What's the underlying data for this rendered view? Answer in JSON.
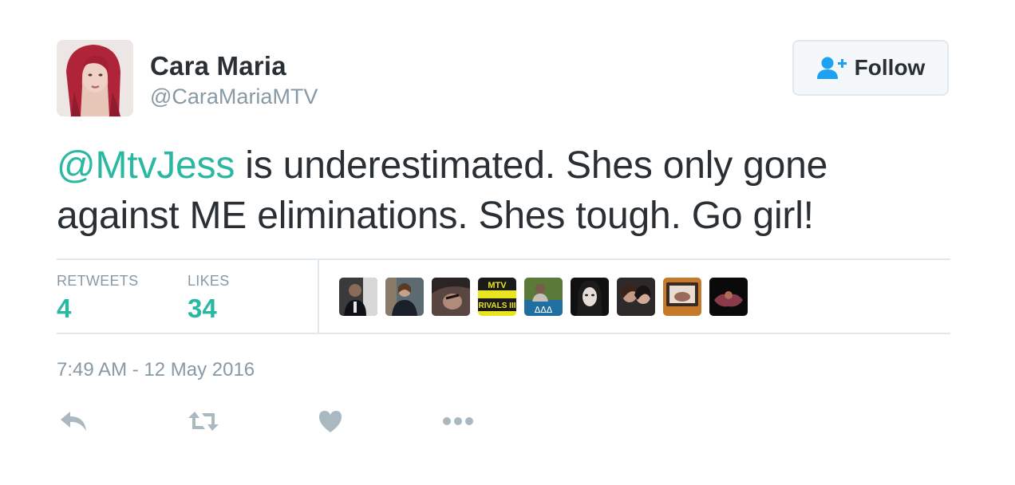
{
  "user": {
    "name": "Cara Maria",
    "handle": "@CaraMariaMTV"
  },
  "follow_button": {
    "label": "Follow",
    "icon": "add-user-icon"
  },
  "tweet": {
    "mention": "@MtvJess",
    "line1_rest": " is underestimated. Shes only gone",
    "line2": "against ME eliminations. Shes tough. Go girl!"
  },
  "stats": {
    "retweets_label": "RETWEETS",
    "retweets_count": "4",
    "likes_label": "LIKES",
    "likes_count": "34"
  },
  "likers": [
    {
      "name": "liker-avatar-1"
    },
    {
      "name": "liker-avatar-2"
    },
    {
      "name": "liker-avatar-3"
    },
    {
      "name": "liker-avatar-4",
      "text_top": "MTV",
      "text_bottom": "RIVALS III"
    },
    {
      "name": "liker-avatar-5",
      "text": "ΔΔΔ"
    },
    {
      "name": "liker-avatar-6"
    },
    {
      "name": "liker-avatar-7"
    },
    {
      "name": "liker-avatar-8"
    },
    {
      "name": "liker-avatar-9"
    }
  ],
  "timestamp": "7:49 AM - 12 May 2016",
  "actions": [
    "reply-icon",
    "retweet-icon",
    "like-heart-icon",
    "more-icon"
  ],
  "colors": {
    "accent_green": "#2ab8a0",
    "follow_icon_blue": "#1da1f2",
    "muted_gray": "#8899a6",
    "action_gray": "#aab8c2",
    "text_dark": "#292f33"
  }
}
